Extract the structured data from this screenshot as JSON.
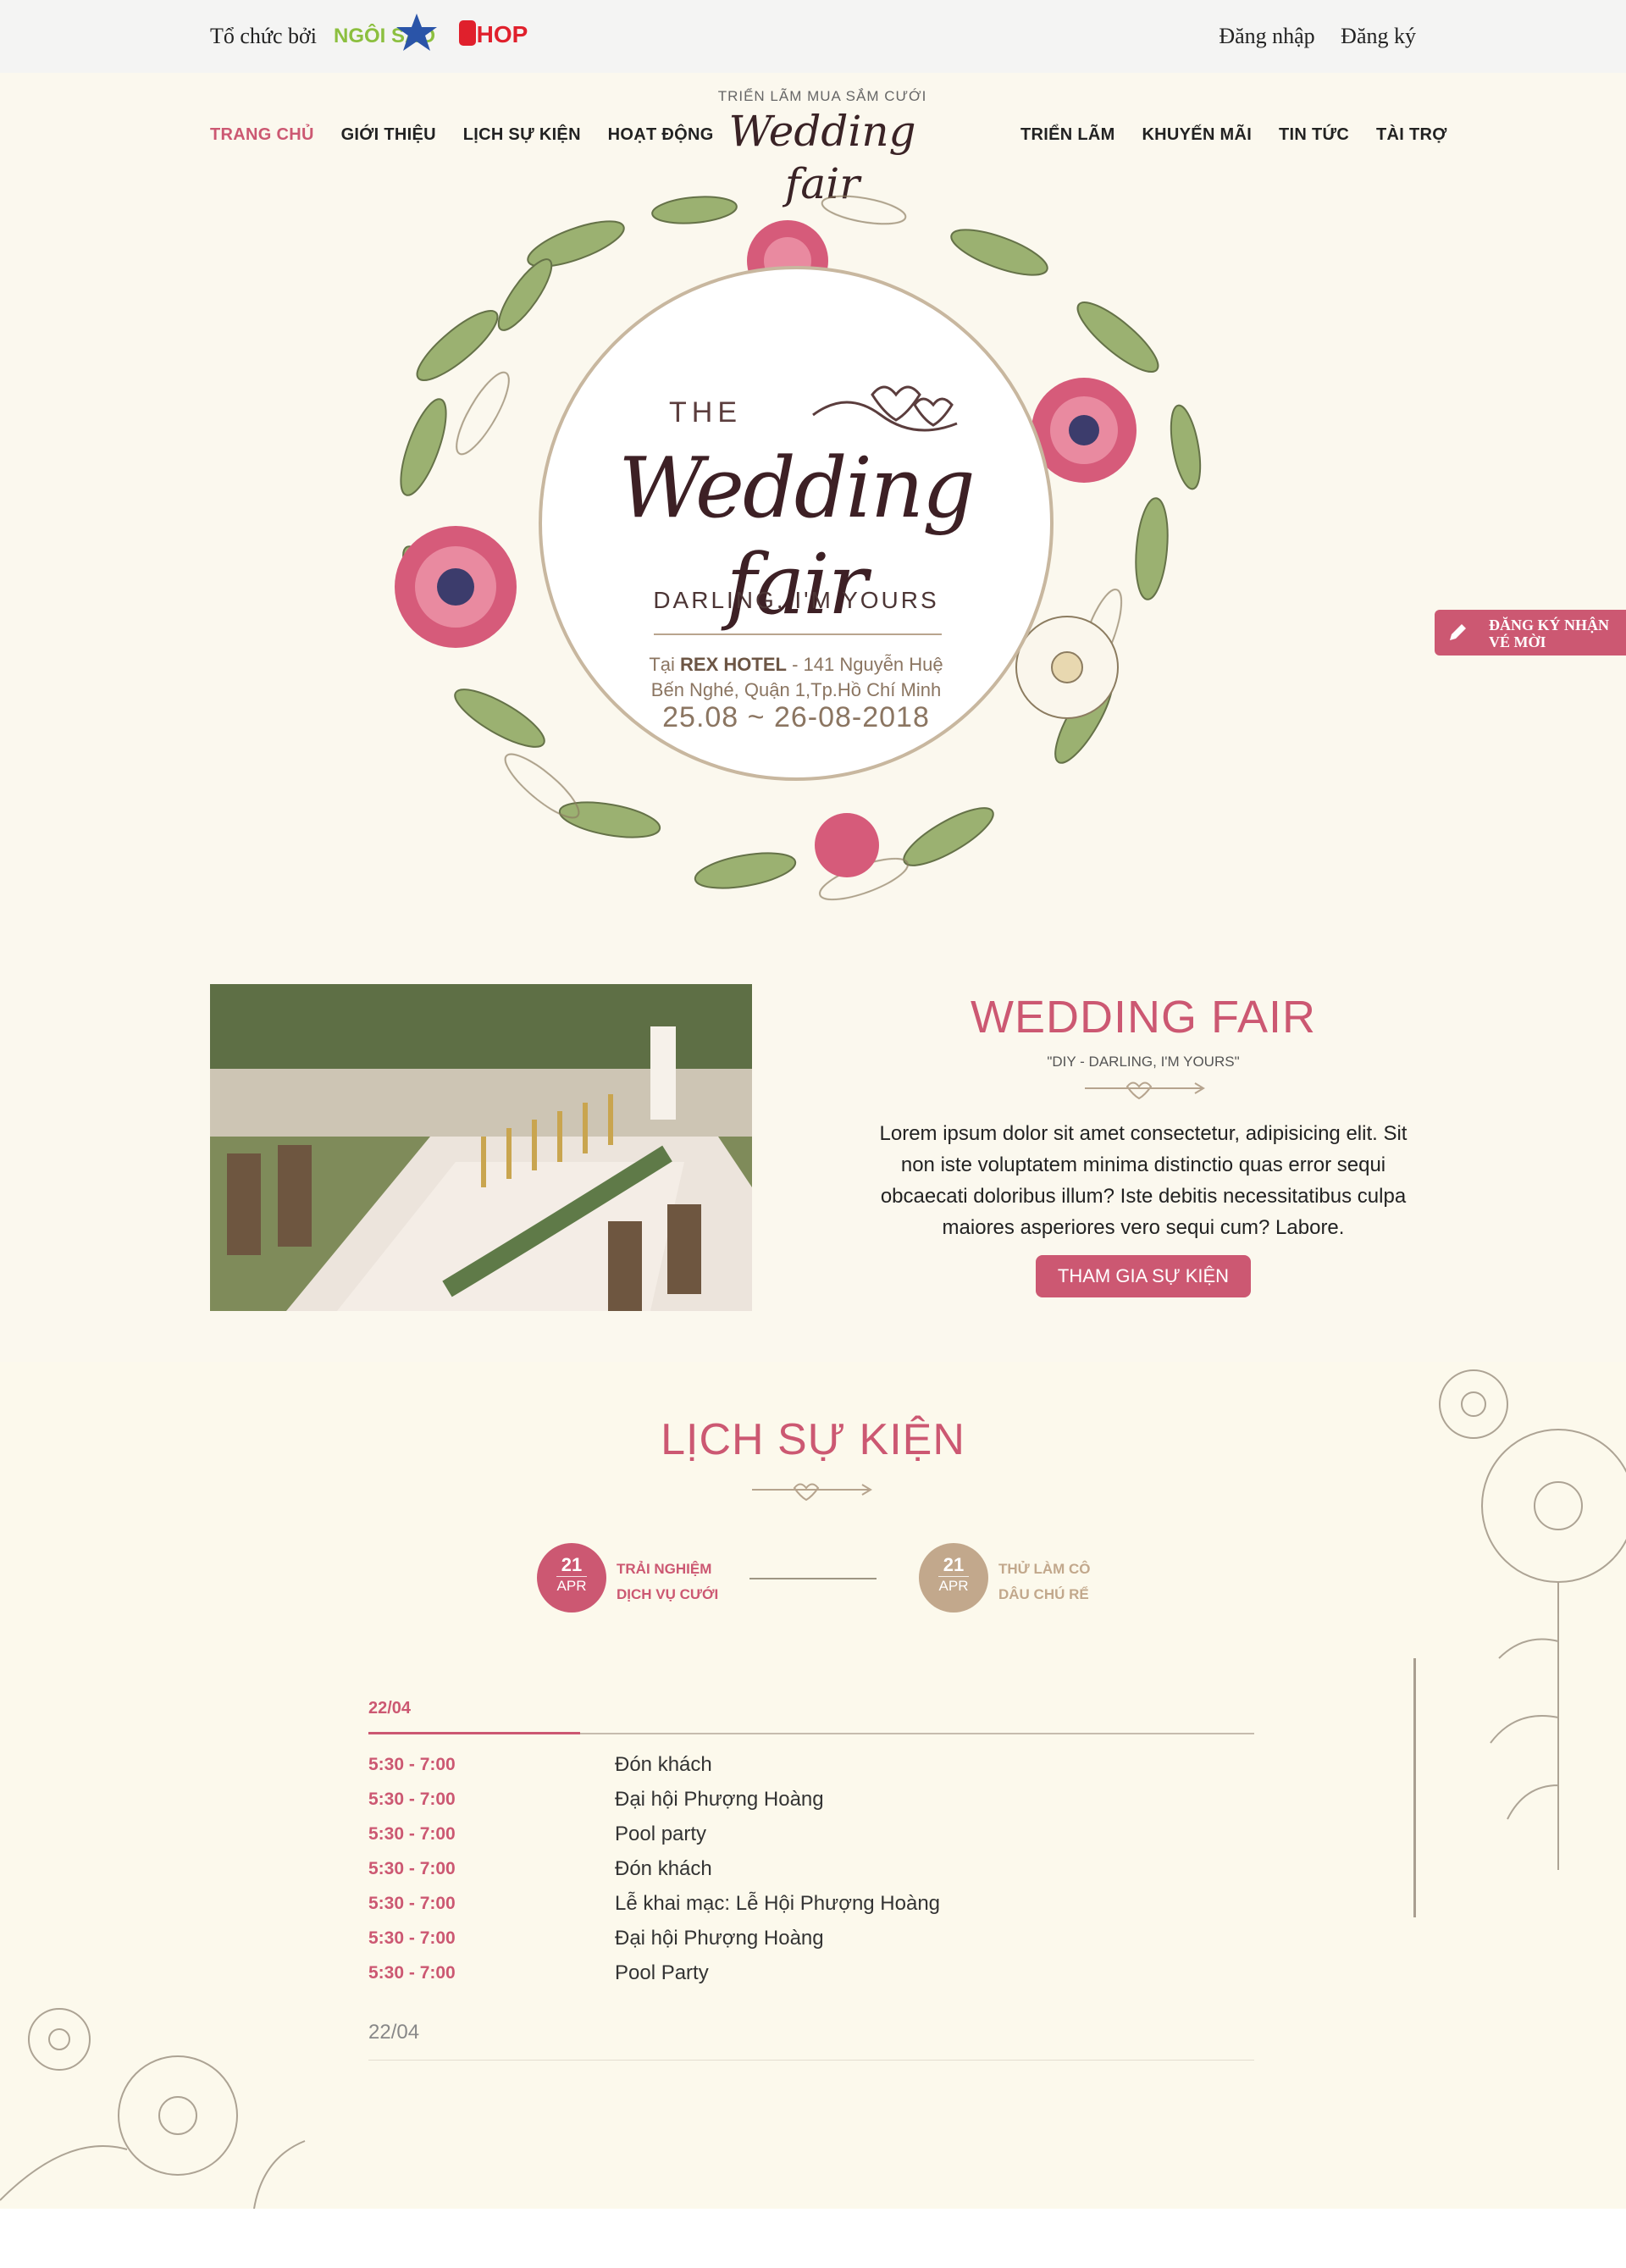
{
  "topbar": {
    "organizer_label": "Tổ chức bởi",
    "sponsors": [
      "NGÔI SAO",
      "SHOP"
    ],
    "login": "Đăng nhập",
    "register": "Đăng ký"
  },
  "nav": {
    "left": [
      "TRANG CHỦ",
      "GIỚI THIỆU",
      "LỊCH SỰ KIỆN",
      "HOẠT ĐỘNG"
    ],
    "right": [
      "TRIỂN LÃM",
      "KHUYẾN MÃI",
      "TIN TỨC",
      "TÀI TRỢ"
    ],
    "active": "TRANG CHỦ"
  },
  "brand": {
    "tagline": "TRIỂN LÃM MUA SẮM CƯỚI",
    "name": "Wedding fair"
  },
  "hero": {
    "the": "THE",
    "title": "Wedding fair",
    "subtitle": "DARLING, I'M YOURS",
    "location_prefix": "Tại",
    "venue": "REX  HOTEL",
    "location_rest": "- 141 Nguyễn Huệ",
    "location_line2": "Bến Nghé, Quận 1,Tp.Hồ Chí Minh",
    "dates": "25.08 ~ 26-08-2018"
  },
  "side_tab": {
    "label_line1": "ĐĂNG KÝ NHẬN",
    "label_line2": "VÉ MỜI"
  },
  "about": {
    "title": "WEDDING FAIR",
    "quote": "\"DIY - DARLING, I'M YOURS\"",
    "text": "Lorem ipsum dolor sit amet consectetur, adipisicing elit. Sit non iste voluptatem minima distinctio quas error sequi obcaecati doloribus illum? Iste debitis necessitatibus culpa maiores asperiores vero sequi cum? Labore.",
    "button": "THAM GIA SỰ KIỆN"
  },
  "schedule": {
    "title": "LỊCH SỰ KIỆN",
    "events": [
      {
        "day": "21",
        "month": "APR",
        "line1": "TRẢI NGHIỆM",
        "line2": "DỊCH VỤ CƯỚI"
      },
      {
        "day": "21",
        "month": "APR",
        "line1": "THỬ LÀM CÔ",
        "line2": "DÂU CHÚ RỂ"
      }
    ],
    "day_label": "22/04",
    "rows": [
      {
        "time": "5:30 - 7:00",
        "activity": "Đón khách"
      },
      {
        "time": "5:30 - 7:00",
        "activity": "Đại hội Phượng Hoàng"
      },
      {
        "time": "5:30 - 7:00",
        "activity": "Pool party"
      },
      {
        "time": "5:30 - 7:00",
        "activity": "Đón khách"
      },
      {
        "time": "5:30 - 7:00",
        "activity": "Lễ khai mạc: Lễ Hội Phượng Hoàng"
      },
      {
        "time": "5:30 - 7:00",
        "activity": "Đại hội Phượng Hoàng"
      },
      {
        "time": "5:30 - 7:00",
        "activity": "Pool Party"
      }
    ],
    "day2_label": "22/04"
  },
  "colors": {
    "accent": "#cc5872",
    "tan": "#c2a88c",
    "background": "#fbf8ee"
  }
}
